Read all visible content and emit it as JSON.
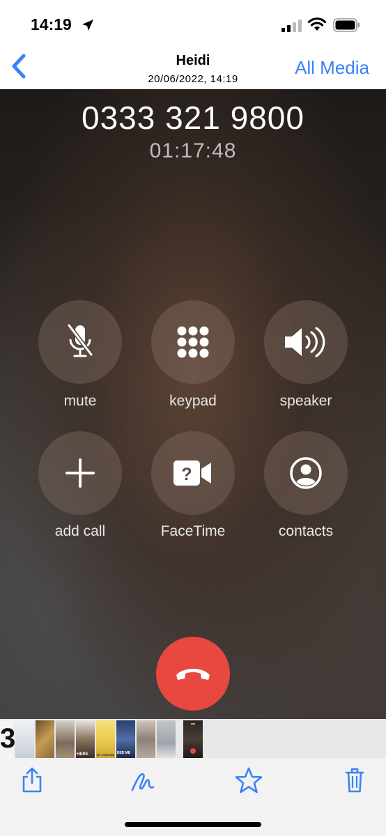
{
  "status_bar": {
    "time": "14:19"
  },
  "nav": {
    "title": "Heidi",
    "subtitle": "20/06/2022, 14:19",
    "right_label": "All Media"
  },
  "call": {
    "number": "0333 321 9800",
    "duration": "01:17:48",
    "buttons": {
      "mute": "mute",
      "keypad": "keypad",
      "speaker": "speaker",
      "add_call": "add call",
      "facetime": "FaceTime",
      "contacts": "contacts"
    }
  },
  "filmstrip": {
    "first_thumb_text": "3",
    "thumb_text_1": "HERE",
    "thumb_text_2": "MY CHICKEN",
    "thumb_text_3": "EED ME"
  },
  "colors": {
    "accent": "#3b82f6",
    "end_call": "#e8483f"
  }
}
